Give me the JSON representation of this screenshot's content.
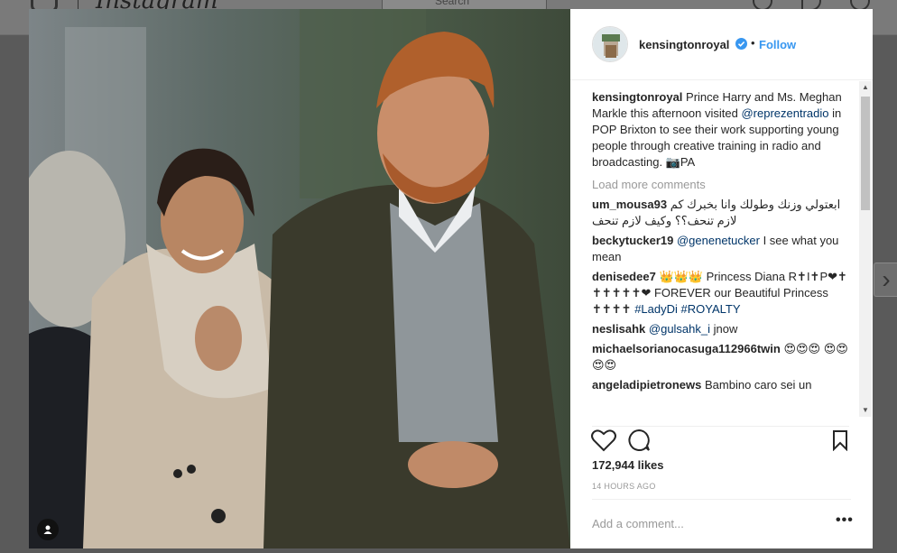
{
  "background": {
    "app_name": "Instagram",
    "search_placeholder": "Search"
  },
  "post": {
    "username": "kensingtonroyal",
    "follow_label": "Follow",
    "separator": "•",
    "caption": {
      "username": "kensingtonroyal",
      "text_before": "Prince Harry and Ms. Meghan Markle this afternoon visited",
      "mention": "@reprezentradio",
      "text_after": "in POP Brixton to see their work supporting young people through creative training in radio and broadcasting. 📷PA"
    },
    "load_more": "Load more comments",
    "comments": [
      {
        "username": "um_mousa93",
        "text": "ابعتولي وزنك وطولك وانا بخبرك كم لازم تنحف؟؟ وكيف لازم تنحف"
      },
      {
        "username": "beckytucker19",
        "mention": "@genenetucker",
        "text": "I see what you mean"
      },
      {
        "username": "denisedee7",
        "text": "👑👑👑 Princess Diana R✝I✝P❤✝ ✝✝✝✝✝❤ FOREVER our Beautiful Princess ✝✝✝✝",
        "tags": "#LadyDi #ROYALTY"
      },
      {
        "username": "neslisahk",
        "mention": "@gulsahk_i",
        "text": "jnow"
      },
      {
        "username": "michaelsorianocasuga112966twin",
        "text": "😍😍😍 😍😍😍😍"
      },
      {
        "username": "angeladipietronews",
        "text": "Bambino caro sei un"
      }
    ],
    "likes": "172,944 likes",
    "time": "14 HOURS AGO",
    "add_comment_placeholder": "Add a comment...",
    "more_label": "•••"
  },
  "colors": {
    "accent": "#3897f0",
    "mention": "#003569",
    "muted": "#999999"
  },
  "icons": [
    "heart-icon",
    "comment-icon",
    "bookmark-icon",
    "verified-icon",
    "tag-user-icon",
    "chevron-right-icon"
  ]
}
